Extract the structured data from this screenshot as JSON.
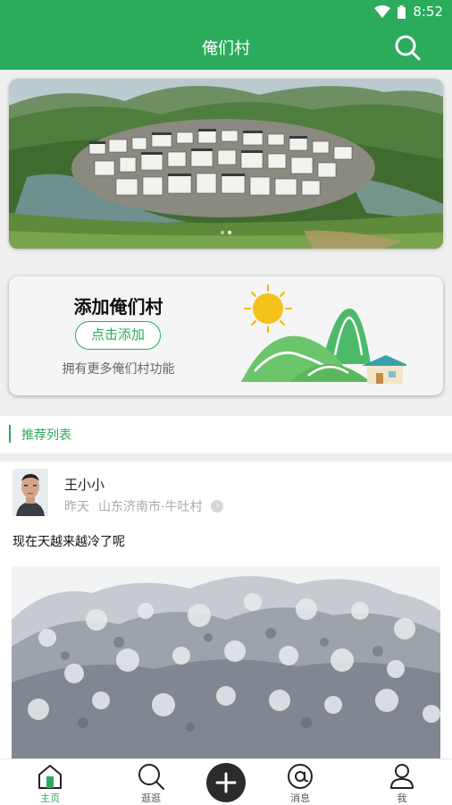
{
  "status": {
    "time": "8:52"
  },
  "header": {
    "title": "俺们村"
  },
  "add_card": {
    "title": "添加俺们村",
    "button_label": "点击添加",
    "subtitle": "拥有更多俺们村功能"
  },
  "section": {
    "title": "推荐列表"
  },
  "post": {
    "username": "王小小",
    "time": "昨天",
    "location": "山东济南市·牛吐村",
    "content": "现在天越来越冷了呢"
  },
  "tabbar": {
    "items": [
      {
        "label": "主页",
        "icon": "home-icon",
        "active": true
      },
      {
        "label": "逛逛",
        "icon": "browse-search-icon"
      },
      {
        "label": "",
        "icon": "plus-icon"
      },
      {
        "label": "消息",
        "icon": "at-message-icon"
      },
      {
        "label": "我",
        "icon": "person-icon"
      }
    ]
  },
  "colors": {
    "primary": "#2bac5c",
    "tabbar_plus": "#2b2b2b"
  }
}
